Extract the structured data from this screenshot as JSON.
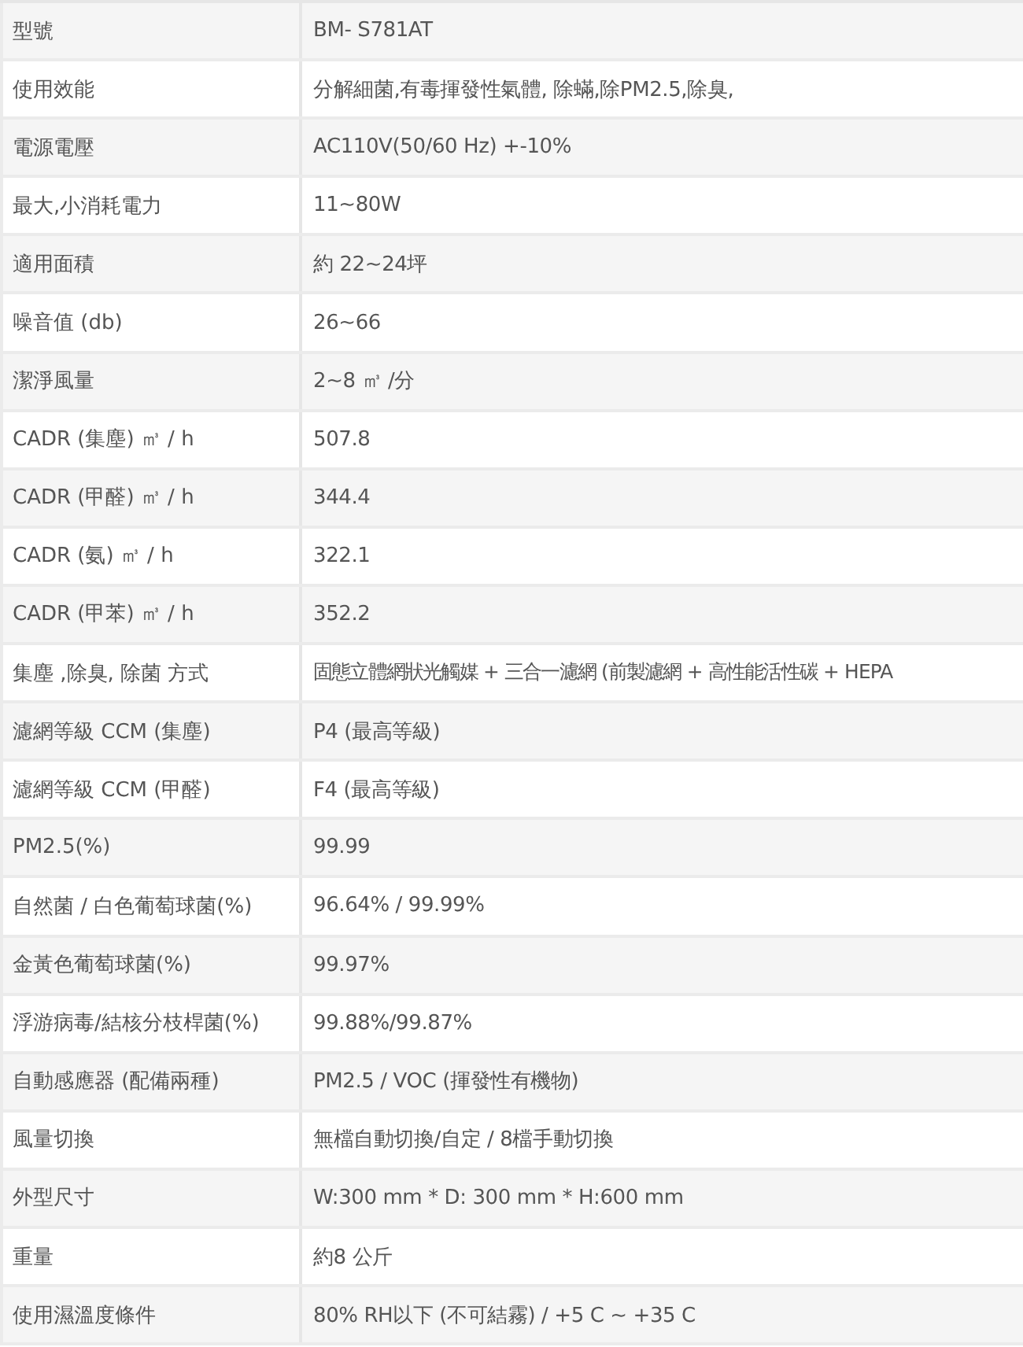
{
  "spec_table": {
    "rows": [
      {
        "label": "型號",
        "value": "BM- S781AT"
      },
      {
        "label": "使用效能",
        "value": "分解細菌,有毒揮發性氣體, 除蟎,除PM2.5,除臭,"
      },
      {
        "label": "電源電壓",
        "value": "AC110V(50/60 Hz) +-10%"
      },
      {
        "label": "最大,小消耗電力",
        "value": "11~80W"
      },
      {
        "label": "適用面積",
        "value": "約 22~24坪"
      },
      {
        "label": "噪音值 (db)",
        "value": "26~66"
      },
      {
        "label": "潔淨風量",
        "value": "2~8 ㎥ /分"
      },
      {
        "label": "CADR (集塵) ㎥ / h",
        "value": "507.8"
      },
      {
        "label": "CADR (甲醛) ㎥ / h",
        "value": "344.4"
      },
      {
        "label": "CADR (氨) ㎥ / h",
        "value": "322.1"
      },
      {
        "label": "CADR (甲苯) ㎥ / h",
        "value": "352.2"
      },
      {
        "label": "集塵 ,除臭, 除菌 方式",
        "value": "固態立體網狀光觸媒 + 三合一濾網  (前製濾網 + 高性能活性碳 + HEPA"
      },
      {
        "label": "濾網等級 CCM (集塵)",
        "value": "P4 (最高等級)"
      },
      {
        "label": "濾網等級 CCM (甲醛)",
        "value": "F4 (最高等級)"
      },
      {
        "label": "PM2.5(%)",
        "value": "99.99"
      },
      {
        "label": "自然菌 / 白色葡萄球菌(%)",
        "value": "96.64% / 99.99%"
      },
      {
        "label": "金黃色葡萄球菌(%)",
        "value": "99.97%"
      },
      {
        "label": "浮游病毒/結核分枝桿菌(%)",
        "value": "99.88%/99.87%"
      },
      {
        "label": "自動感應器 (配備兩種)",
        "value": "PM2.5 / VOC (揮發性有機物)"
      },
      {
        "label": "風量切換",
        "value": "無檔自動切換/自定 / 8檔手動切換"
      },
      {
        "label": "外型尺寸",
        "value": "W:300 mm * D: 300 mm * H:600 mm"
      },
      {
        "label": "重量",
        "value": "約8 公斤"
      },
      {
        "label": "使用濕溫度條件",
        "value": "80% RH以下 (不可結霧) / +5 C ~ +35 C"
      }
    ]
  }
}
